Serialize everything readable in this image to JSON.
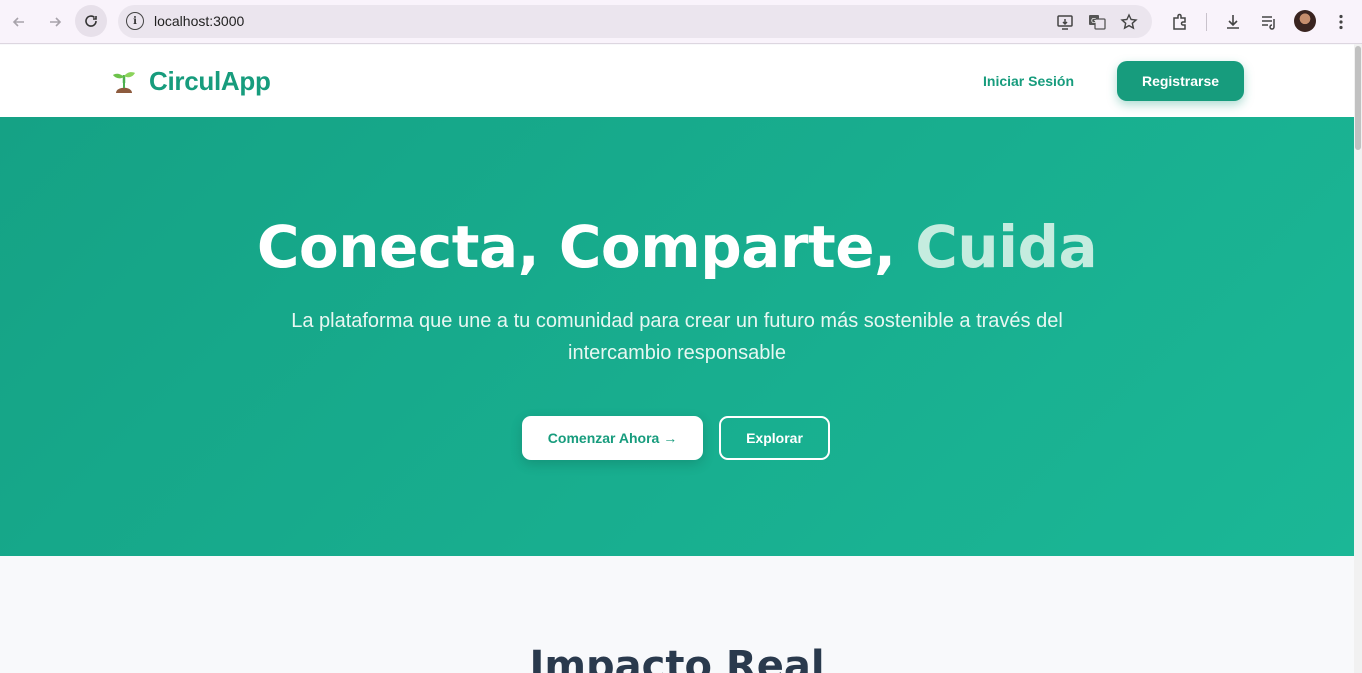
{
  "browser": {
    "url": "localhost:3000"
  },
  "header": {
    "brand": "CirculApp",
    "login_label": "Iniciar Sesión",
    "register_label": "Registrarse"
  },
  "hero": {
    "title_main": "Conecta, Comparte, ",
    "title_accent": "Cuida",
    "subtitle": "La plataforma que une a tu comunidad para crear un futuro más sostenible a través del intercambio responsable",
    "primary_cta": "Comenzar Ahora →",
    "secondary_cta": "Explorar"
  },
  "impact": {
    "title": "Impacto Real"
  },
  "colors": {
    "brand": "#179c7d",
    "hero_bg": "#18ae8f",
    "accent_text": "#c5ecdf",
    "heading": "#2a3a4d"
  }
}
